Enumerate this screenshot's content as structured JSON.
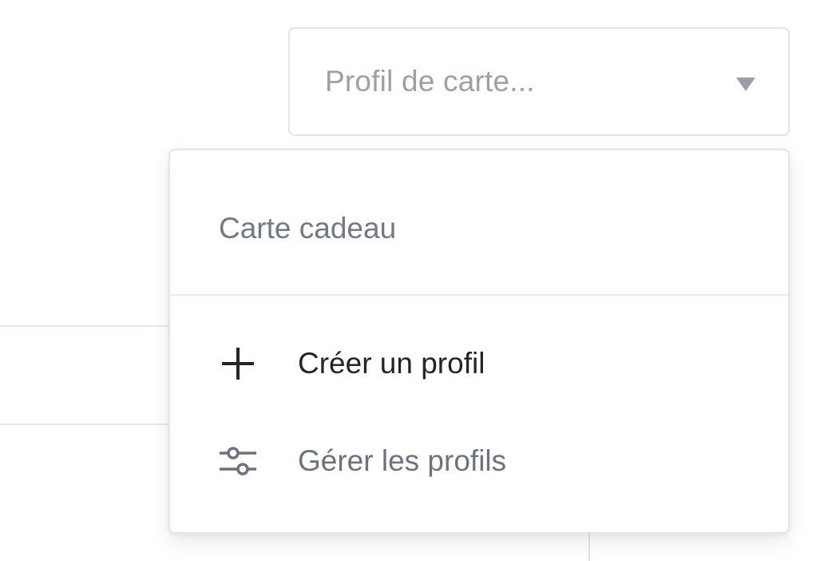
{
  "select": {
    "placeholder": "Profil de carte..."
  },
  "menu": {
    "options": [
      {
        "label": "Carte cadeau"
      }
    ],
    "actions": {
      "create": {
        "label": "Créer un profil",
        "icon": "plus-icon"
      },
      "manage": {
        "label": "Gérer les profils",
        "icon": "sliders-icon"
      }
    }
  },
  "colors": {
    "border": "#e3e4e8",
    "placeholder_text": "#9a9fa8",
    "primary_text": "#23252b",
    "secondary_text": "#737887"
  }
}
